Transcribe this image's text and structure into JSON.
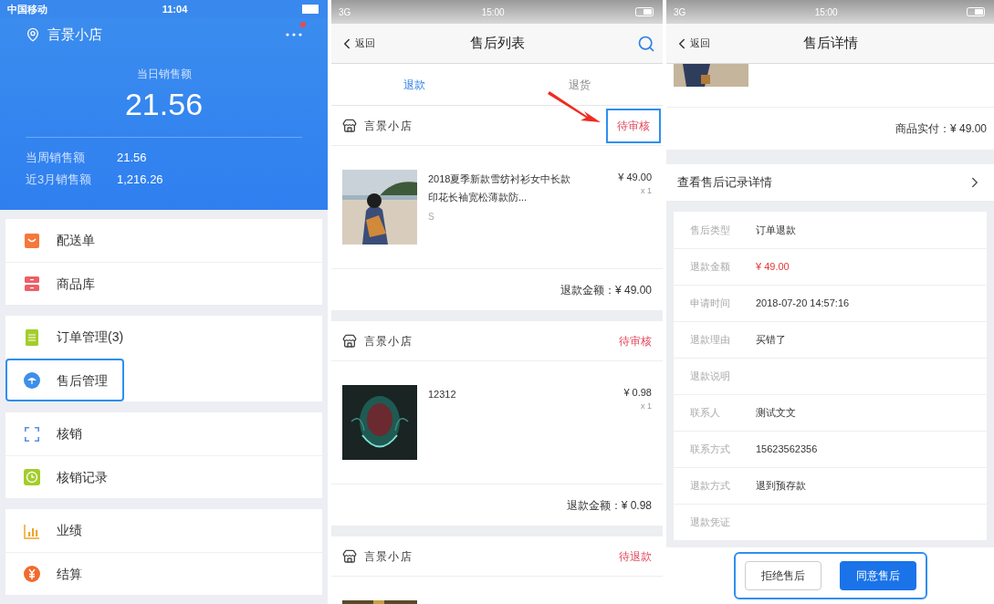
{
  "home": {
    "status_bar": {
      "carrier": "中国移动",
      "time": "11:04"
    },
    "store_name": "言景小店",
    "notification_dot": true,
    "today_label": "当日销售额",
    "today_value": "21.56",
    "stats": [
      {
        "label": "当周销售额",
        "value": "21.56"
      },
      {
        "label": "近3月销售额",
        "value": "1,216.26"
      }
    ],
    "menu_groups": [
      [
        {
          "label": "配送单",
          "kind": "bag",
          "color": "#f5783c",
          "highlighted": false
        },
        {
          "label": "商品库",
          "kind": "drawer",
          "color": "#ec5f67",
          "highlighted": false
        }
      ],
      [
        {
          "label": "订单管理(3)",
          "kind": "list",
          "color": "#a3cd2b",
          "highlighted": false
        },
        {
          "label": "售后管理",
          "kind": "umbrella",
          "color": "#3d8fe8",
          "highlighted": true
        }
      ],
      [
        {
          "label": "核销",
          "kind": "scan",
          "color": "#5b8ee0",
          "highlighted": false
        },
        {
          "label": "核销记录",
          "kind": "clock",
          "color": "#a3cd2b",
          "highlighted": false
        }
      ],
      [
        {
          "label": "业绩",
          "kind": "chart",
          "color": "#f0a52a",
          "highlighted": false
        },
        {
          "label": "结算",
          "kind": "yen",
          "color": "#f26a2e",
          "highlighted": false
        }
      ]
    ]
  },
  "after_sales_list": {
    "status_bar": {
      "network": "3G",
      "time": "15:00"
    },
    "back": "返回",
    "title": "售后列表",
    "tabs": [
      {
        "label": "退款",
        "selected": true
      },
      {
        "label": "退货",
        "selected": false
      }
    ],
    "orders": [
      {
        "store": "言景小店",
        "status": "待审核",
        "highlighted": true,
        "item": {
          "kind": "picture",
          "title": "2018夏季新款雪纺衬衫女中长款印花长袖宽松薄款防...",
          "spec": "S",
          "price": "¥ 49.00",
          "qty": "x 1"
        },
        "total": "退款金额：¥ 49.00"
      },
      {
        "store": "言景小店",
        "status": "待审核",
        "highlighted": false,
        "item": {
          "kind": "picture",
          "title": "12312",
          "price": "¥ 0.98",
          "qty": "x 1"
        },
        "total": "退款金额：¥ 0.98"
      },
      {
        "store": "言景小店",
        "status": "待退款",
        "highlighted": false
      }
    ]
  },
  "after_sales_detail": {
    "status_bar": {
      "network": "3G",
      "time": "15:00"
    },
    "back": "返回",
    "title": "售后详情",
    "paid": "商品实付：¥ 49.00",
    "record_link": "查看售后记录详情",
    "fields": [
      {
        "label": "售后类型",
        "value": "订单退款",
        "kind": "text"
      },
      {
        "label": "退款金额",
        "value": "¥ 49.00",
        "kind": "amount"
      },
      {
        "label": "申请时间",
        "value": "2018-07-20 14:57:16",
        "kind": "text"
      },
      {
        "label": "退款理由",
        "value": "买错了",
        "kind": "text"
      },
      {
        "label": "退款说明"
      },
      {
        "label": "联系人",
        "value": "测试文文",
        "kind": "text"
      },
      {
        "label": "联系方式",
        "value": "15623562356",
        "kind": "text"
      },
      {
        "label": "退款方式",
        "value": "退到预存款",
        "kind": "text"
      },
      {
        "label": "退款凭证"
      }
    ],
    "actions_highlighted": true,
    "actions": [
      {
        "label": "拒绝售后",
        "primary": false
      },
      {
        "label": "同意售后",
        "primary": true
      }
    ]
  }
}
